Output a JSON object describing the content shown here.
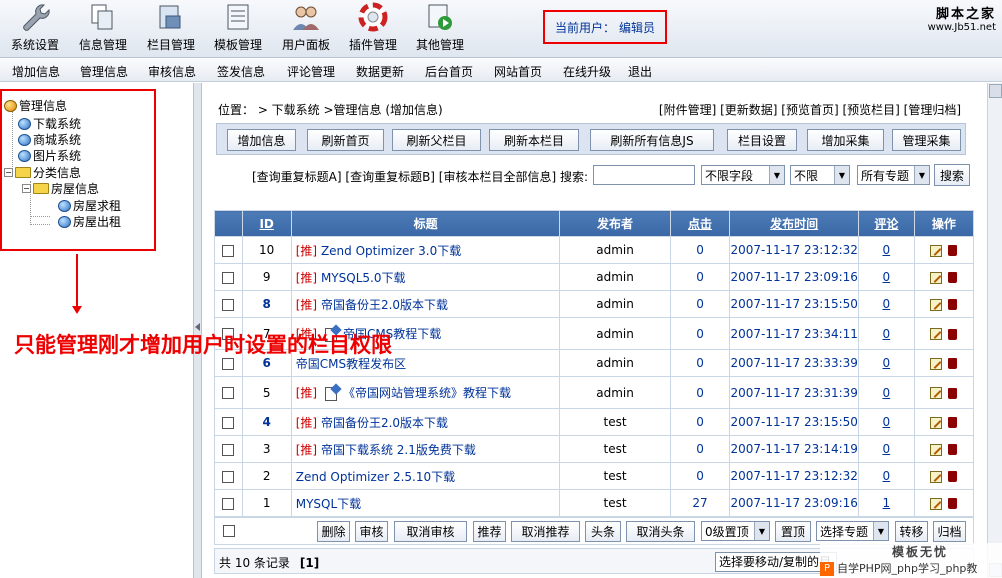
{
  "toolbar": {
    "items": [
      "系统设置",
      "信息管理",
      "栏目管理",
      "模板管理",
      "用户面板",
      "插件管理",
      "其他管理"
    ],
    "current_user_label": "当前用户：",
    "current_user": "编辑员"
  },
  "logo": {
    "line1": "脚本之家",
    "line2": "www.Jb51.net"
  },
  "menu": [
    "增加信息",
    "管理信息",
    "审核信息",
    "签发信息",
    "评论管理",
    "数据更新",
    "后台首页",
    "网站首页",
    "在线升级",
    "退出"
  ],
  "tree": {
    "root": "管理信息",
    "nodes": [
      "下载系统",
      "商城系统",
      "图片系统",
      "分类信息",
      "房屋信息",
      "房屋求租",
      "房屋出租"
    ],
    "expand_minus": "−"
  },
  "annotation": "只能管理刚才增加用户时设置的栏目权限",
  "main": {
    "crumb": "位置： > 下载系统 >管理信息 (增加信息)",
    "right_links": "[附件管理] [更新数据] [预览首页] [预览栏目] [管理归档]",
    "buttons": [
      "增加信息",
      "刷新首页",
      "刷新父栏目",
      "刷新本栏目",
      "刷新所有信息JS",
      "栏目设置",
      "增加采集",
      "管理采集"
    ],
    "search_links": "[查询重复标题A] [查询重复标题B] [审核本栏目全部信息] 搜索:",
    "select_field": "不限字段",
    "select_limit": "不限",
    "select_topic": "所有专题",
    "search_btn": "搜索",
    "dropdown_arrow": "▼"
  },
  "table": {
    "headers": [
      "ID",
      "标题",
      "发布者",
      "点击",
      "发布时间",
      "评论",
      "操作"
    ],
    "tui_label": "[推]",
    "rows": [
      {
        "id": "10",
        "tui": true,
        "doc": false,
        "title": "Zend Optimizer 3.0下载",
        "author": "admin",
        "clicks": "0",
        "date": "2007-11-17 23:12:32",
        "comments": "0"
      },
      {
        "id": "9",
        "tui": true,
        "doc": false,
        "title": "MYSQL5.0下载",
        "author": "admin",
        "clicks": "0",
        "date": "2007-11-17 23:09:16",
        "comments": "0"
      },
      {
        "id": "8",
        "tui": true,
        "doc": false,
        "title": "帝国备份王2.0版本下载",
        "author": "admin",
        "clicks": "0",
        "date": "2007-11-17 23:15:50",
        "comments": "0"
      },
      {
        "id": "7",
        "tui": true,
        "doc": true,
        "title": "帝国CMS教程下载",
        "author": "admin",
        "clicks": "0",
        "date": "2007-11-17 23:34:11",
        "comments": "0"
      },
      {
        "id": "6",
        "tui": false,
        "doc": false,
        "title": "帝国CMS教程发布区",
        "author": "admin",
        "clicks": "0",
        "date": "2007-11-17 23:33:39",
        "comments": "0"
      },
      {
        "id": "5",
        "tui": true,
        "doc": true,
        "title": "《帝国网站管理系统》教程下载",
        "author": "admin",
        "clicks": "0",
        "date": "2007-11-17 23:31:39",
        "comments": "0"
      },
      {
        "id": "4",
        "tui": true,
        "doc": false,
        "title": "帝国备份王2.0版本下载",
        "author": "test",
        "clicks": "0",
        "date": "2007-11-17 23:15:50",
        "comments": "0"
      },
      {
        "id": "3",
        "tui": true,
        "doc": false,
        "title": "帝国下载系统 2.1版免费下载",
        "author": "test",
        "clicks": "0",
        "date": "2007-11-17 23:14:19",
        "comments": "0"
      },
      {
        "id": "2",
        "tui": false,
        "doc": false,
        "title": "Zend Optimizer 2.5.10下载",
        "author": "test",
        "clicks": "0",
        "date": "2007-11-17 23:12:32",
        "comments": "0"
      },
      {
        "id": "1",
        "tui": false,
        "doc": false,
        "title": "MYSQL下载",
        "author": "test",
        "clicks": "27",
        "date": "2007-11-17 23:09:16",
        "comments": "1"
      }
    ]
  },
  "actions": {
    "buttons": [
      "删除",
      "审核",
      "取消审核",
      "推荐",
      "取消推荐",
      "头条",
      "取消头条",
      "置顶",
      "转移",
      "归档"
    ],
    "level_select": "0级置顶",
    "topic_select": "选择专题"
  },
  "footer": {
    "count": "共 10 条记录",
    "page": "[1]",
    "move_select": "选择要移动/复制的目"
  },
  "watermark": {
    "text": "自学PHP网_php学习_php教",
    "brand": "模板无忧",
    "p": "P"
  }
}
